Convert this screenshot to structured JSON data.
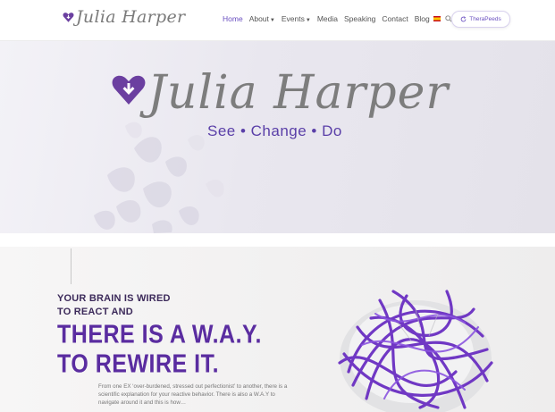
{
  "header": {
    "logo_text": "Julia Harper",
    "nav": [
      {
        "label": "Home",
        "active": true
      },
      {
        "label": "About",
        "dropdown": true
      },
      {
        "label": "Events",
        "dropdown": true
      },
      {
        "label": "Media"
      },
      {
        "label": "Speaking"
      },
      {
        "label": "Contact"
      },
      {
        "label": "Blog"
      }
    ],
    "therapeeds_label": "TheraPeeds"
  },
  "hero": {
    "title": "Julia Harper",
    "tagline": "See  •  Change  •  Do"
  },
  "section": {
    "line1": "YOUR BRAIN IS WIRED",
    "line2": "TO REACT AND",
    "big1": "THERE IS A W.A.Y.",
    "big2": "TO REWIRE IT.",
    "body": "From one EX ‘over-burdened, stressed out perfectionist’ to another, there is a scientific explanation for your reactive behavior. There is also a W.A.Y to navigate around it and this is how…"
  },
  "colors": {
    "brand_purple": "#5a2ca0",
    "nav_active": "#6a4fc0",
    "heart": "#6b3fa0"
  }
}
